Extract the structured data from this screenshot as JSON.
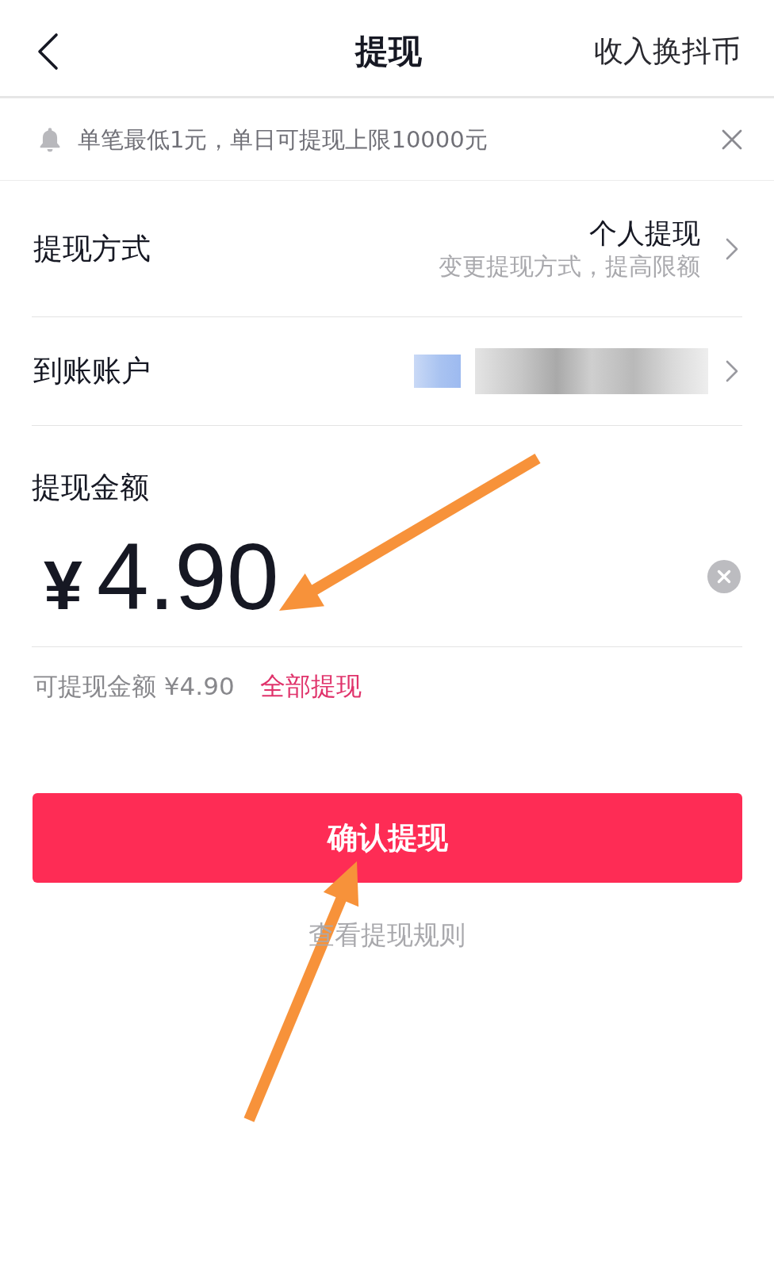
{
  "header": {
    "title": "提现",
    "action": "收入换抖币"
  },
  "notice": {
    "text": "单笔最低1元，单日可提现上限10000元"
  },
  "rows": [
    {
      "kind": "method",
      "label": "提现方式",
      "value": "个人提现",
      "hint": "变更提现方式，提高限额"
    },
    {
      "kind": "account",
      "label": "到账账户"
    }
  ],
  "amount": {
    "label": "提现金额",
    "currency": "¥",
    "value": "4.90",
    "available": "可提现金额 ¥4.90",
    "withdraw_all": "全部提现"
  },
  "confirm_button": "确认提现",
  "rules_link": "查看提现规则"
}
